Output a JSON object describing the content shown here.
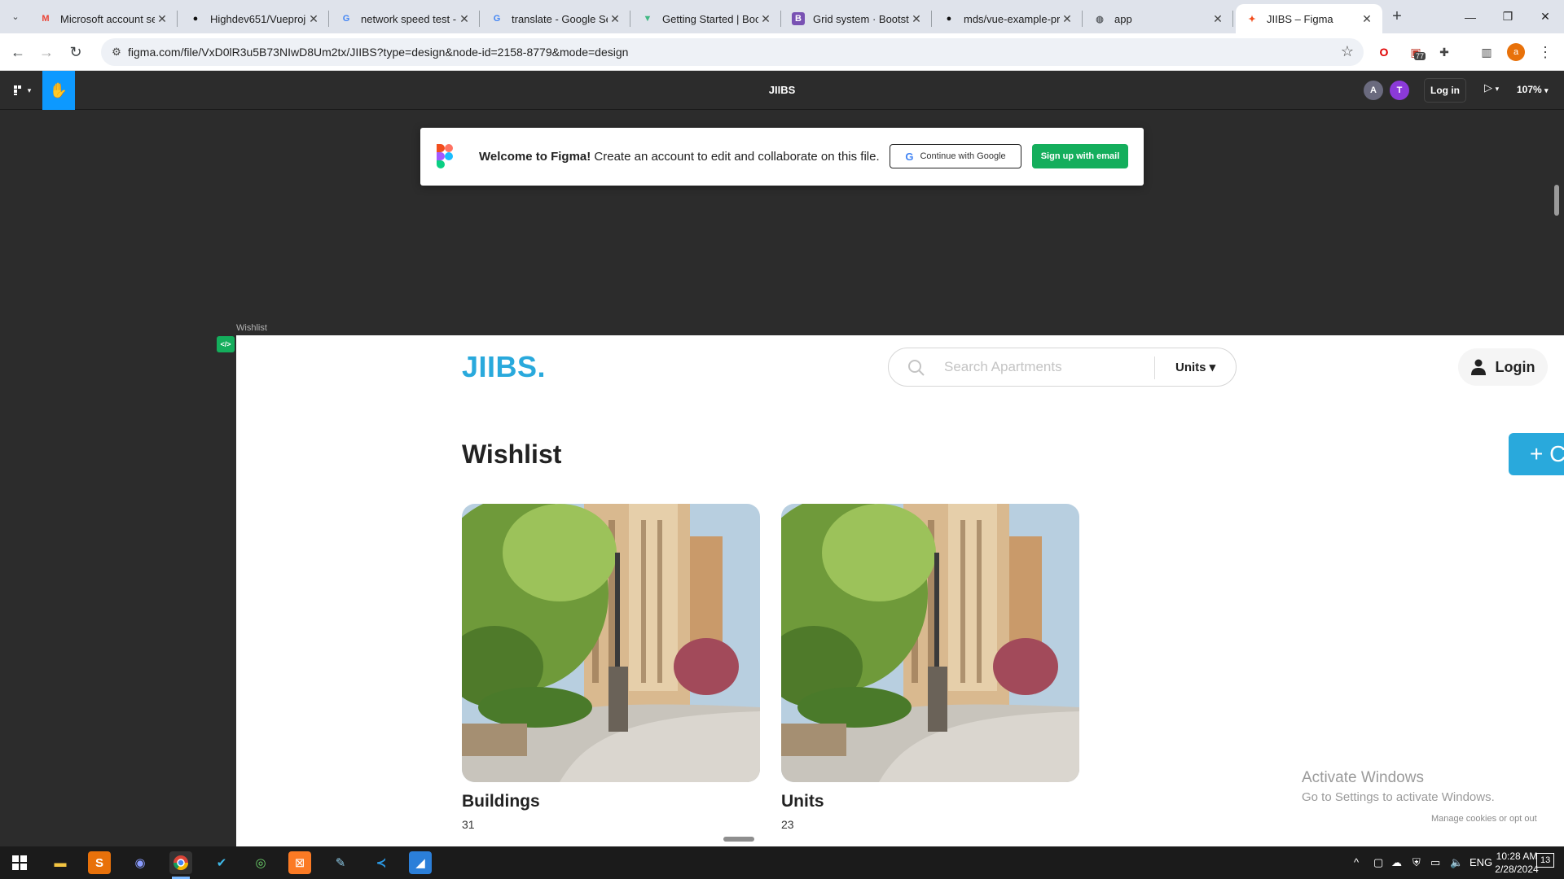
{
  "browser": {
    "tabs": [
      {
        "title": "Microsoft account se",
        "icon": "gmail-icon",
        "glyph": "M",
        "color": "#ea4335"
      },
      {
        "title": "Highdev651/Vueproj",
        "icon": "github-icon",
        "glyph": "●",
        "color": "#111111"
      },
      {
        "title": "network speed test -",
        "icon": "google-icon",
        "glyph": "G",
        "color": "#4285f4"
      },
      {
        "title": "translate - Google Se",
        "icon": "google-icon",
        "glyph": "G",
        "color": "#4285f4"
      },
      {
        "title": "Getting Started | Boo",
        "icon": "vue-icon",
        "glyph": "▼",
        "color": "#41b883"
      },
      {
        "title": "Grid system · Bootstr",
        "icon": "bootstrap-icon",
        "glyph": "B",
        "color": "#7952b3"
      },
      {
        "title": "mds/vue-example-pr",
        "icon": "github-icon",
        "glyph": "●",
        "color": "#111111"
      },
      {
        "title": "app",
        "icon": "globe-icon",
        "glyph": "◍",
        "color": "#5f6368"
      },
      {
        "title": "JIIBS – Figma",
        "icon": "figma-icon",
        "glyph": "✦",
        "color": "#f24e1e"
      }
    ],
    "url": "figma.com/file/VxD0lR3u5B73NIwD8Um2tx/JIIBS?type=design&node-id=2158-8779&mode=design",
    "extensions": [
      {
        "icon": "opera-icon",
        "glyph": "O",
        "color": "#e00000"
      },
      {
        "icon": "extension-badge-icon",
        "glyph": "▣",
        "color": "#c0392b",
        "badge": "77"
      },
      {
        "icon": "puzzle-icon",
        "glyph": "✚",
        "color": "#444444"
      },
      {
        "icon": "sidepanel-icon",
        "glyph": "▥",
        "color": "#444444"
      },
      {
        "icon": "profile-icon",
        "glyph": "a",
        "color": "#e8710a"
      },
      {
        "icon": "menu-dots-icon",
        "glyph": "⋮",
        "color": "#444444"
      }
    ]
  },
  "figma": {
    "file_title": "JIIBS",
    "avatars": [
      {
        "letter": "A",
        "color": "#6a6a7e"
      },
      {
        "letter": "T",
        "color": "#8b3ad9"
      }
    ],
    "login_label": "Log in",
    "zoom": "107%",
    "welcome": {
      "bold": "Welcome to Figma!",
      "text": " Create an account to edit and collaborate on this file.",
      "google_btn": "Continue with Google",
      "email_btn": "Sign up with email"
    },
    "frame_label": "Wishlist",
    "dev_badge": "</>"
  },
  "site": {
    "brand": "JIIBS.",
    "search_placeholder": "Search Apartments",
    "units_dropdown": "Units ▾",
    "login_label": "Login",
    "page_title": "Wishlist",
    "create_btn": "+ C",
    "cards": [
      {
        "title": "Buildings",
        "count": "31"
      },
      {
        "title": "Units",
        "count": "23"
      }
    ]
  },
  "overlay": {
    "activate_title": "Activate Windows",
    "activate_sub": "Go to Settings to activate Windows.",
    "cookies": "Manage cookies or opt out"
  },
  "taskbar": {
    "time": "10:28 AM",
    "date": "2/28/2024",
    "notifications": "13"
  }
}
